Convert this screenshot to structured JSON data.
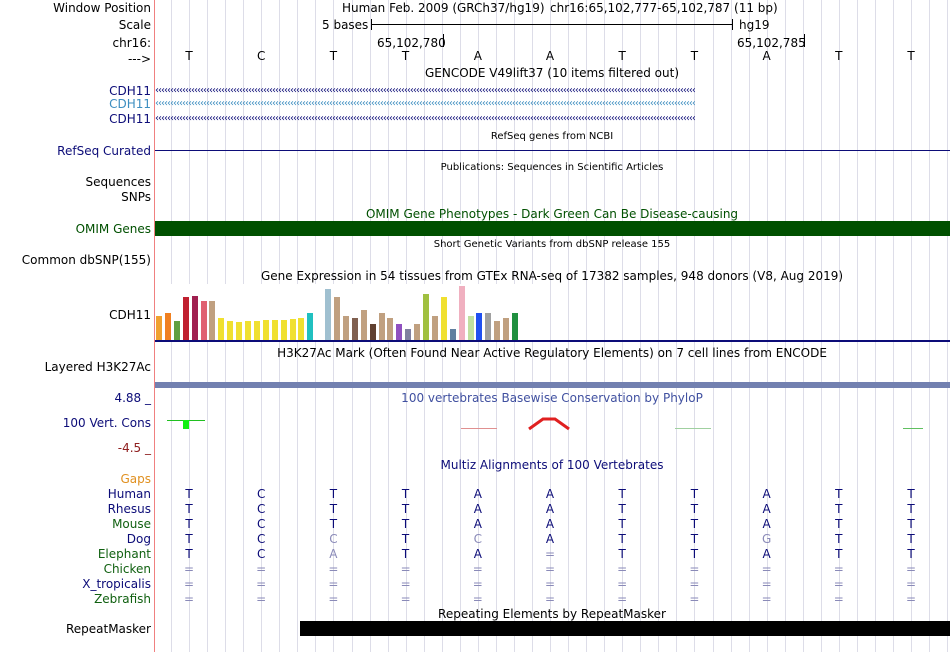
{
  "header": {
    "position_label": "Window Position",
    "scale_label": "Scale",
    "chrom_label": "chr16:",
    "strand_label": "--->",
    "assembly": "Human Feb. 2009 (GRCh37/hg19)",
    "range": "chr16:65,102,777-65,102,787 (11 bp)",
    "scale_text": "5 bases",
    "db": "hg19",
    "coord1": "65,102,780",
    "coord2": "65,102,785",
    "bases": [
      "T",
      "C",
      "T",
      "T",
      "A",
      "A",
      "T",
      "T",
      "A",
      "T",
      "T"
    ]
  },
  "tracks": {
    "gencode": {
      "title": "GENCODE V49lift37 (10 items filtered out)",
      "items": [
        "CDH11",
        "CDH11",
        "CDH11"
      ],
      "colors": [
        "#0c0c78",
        "#3d8ec0",
        "#0c0c78"
      ]
    },
    "refseq": {
      "title": "RefSeq genes from NCBI",
      "label": "RefSeq Curated"
    },
    "pubs": {
      "title": "Publications: Sequences in Scientific Articles",
      "labels": [
        "Sequences",
        "SNPs"
      ]
    },
    "omim": {
      "title": "OMIM Gene Phenotypes - Dark Green Can Be Disease-causing",
      "label": "OMIM Genes",
      "color": "#005000"
    },
    "dbsnp": {
      "title": "Short Genetic Variants from dbSNP release 155",
      "label": "Common dbSNP(155)"
    },
    "gtex": {
      "title": "Gene Expression in 54 tissues from GTEx RNA-seq of 17382 samples, 948 donors (V8, Aug 2019)",
      "label": "CDH11",
      "colors": [
        "#f0a030",
        "#f08020",
        "#60a040",
        "#c02030",
        "#a02050",
        "#e06070",
        "#c0a080",
        "#f0e030",
        "#f0e030",
        "#f0e030",
        "#f0e030",
        "#f0e030",
        "#f0e030",
        "#f0e030",
        "#f0e030",
        "#f0e030",
        "#f0e030",
        "#20c0c0",
        "#ffffff",
        "#a0c0d0",
        "#c0a080",
        "#c0a080",
        "#806050",
        "#c0a080",
        "#604030",
        "#c0a080",
        "#c0a080",
        "#9050c0",
        "#8080a0",
        "#c0a080",
        "#a0c040",
        "#c0a080",
        "#f0e030",
        "#6080a0",
        "#f0b0c0",
        "#c0e0a0",
        "#2050f0",
        "#a0a0a0",
        "#c0a080",
        "#c0a080",
        "#209040",
        "#f0c0c0"
      ],
      "values": [
        0.45,
        0.5,
        0.35,
        0.8,
        0.82,
        0.72,
        0.72,
        0.4,
        0.35,
        0.33,
        0.35,
        0.35,
        0.37,
        0.37,
        0.37,
        0.39,
        0.4,
        0.5,
        0.0,
        0.95,
        0.8,
        0.45,
        0.4,
        0.55,
        0.3,
        0.5,
        0.4,
        0.3,
        0.2,
        0.3,
        0.85,
        0.45,
        0.8,
        0.2,
        1.0,
        0.45,
        0.5,
        0.5,
        0.35,
        0.4,
        0.5,
        0.0
      ]
    },
    "h3k27ac": {
      "title": "H3K27Ac Mark (Often Found Near Active Regulatory Elements) on 7 cell lines from ENCODE",
      "label": "Layered H3K27Ac"
    },
    "phylop": {
      "title": "100 vertebrates Basewise Conservation by PhyloP",
      "label": "100 Vert. Cons",
      "max": "4.88 _",
      "min": "-4.5 _"
    },
    "multiz": {
      "title": "Multiz Alignments of 100 Vertebrates",
      "gaps_label": "Gaps",
      "species": [
        {
          "name": "Human",
          "color": "#0c0c78",
          "seq": [
            "T",
            "C",
            "T",
            "T",
            "A",
            "A",
            "T",
            "T",
            "A",
            "T",
            "T"
          ]
        },
        {
          "name": "Rhesus",
          "color": "#0c0c78",
          "seq": [
            "T",
            "C",
            "T",
            "T",
            "A",
            "A",
            "T",
            "T",
            "A",
            "T",
            "T"
          ]
        },
        {
          "name": "Mouse",
          "color": "#106010",
          "seq": [
            "T",
            "C",
            "T",
            "T",
            "A",
            "A",
            "T",
            "T",
            "A",
            "T",
            "T"
          ]
        },
        {
          "name": "Dog",
          "color": "#0c0c78",
          "seq": [
            "T",
            "C",
            "C",
            "T",
            "C",
            "A",
            "T",
            "T",
            "G",
            "T",
            "T"
          ]
        },
        {
          "name": "Elephant",
          "color": "#106010",
          "seq": [
            "T",
            "C",
            "A",
            "T",
            "A",
            "=",
            "T",
            "T",
            "A",
            "T",
            "T"
          ]
        },
        {
          "name": "Chicken",
          "color": "#106010",
          "seq": [
            "=",
            "=",
            "=",
            "=",
            "=",
            "=",
            "=",
            "=",
            "=",
            "=",
            "="
          ]
        },
        {
          "name": "X_tropicalis",
          "color": "#0c0c78",
          "seq": [
            "=",
            "=",
            "=",
            "=",
            "=",
            "=",
            "=",
            "=",
            "=",
            "=",
            "="
          ]
        },
        {
          "name": "Zebrafish",
          "color": "#106010",
          "seq": [
            "=",
            "=",
            "=",
            "=",
            "=",
            "=",
            "=",
            "=",
            "=",
            "=",
            "="
          ]
        }
      ]
    },
    "repeatmasker": {
      "title": "Repeating Elements by RepeatMasker",
      "label": "RepeatMasker"
    }
  }
}
